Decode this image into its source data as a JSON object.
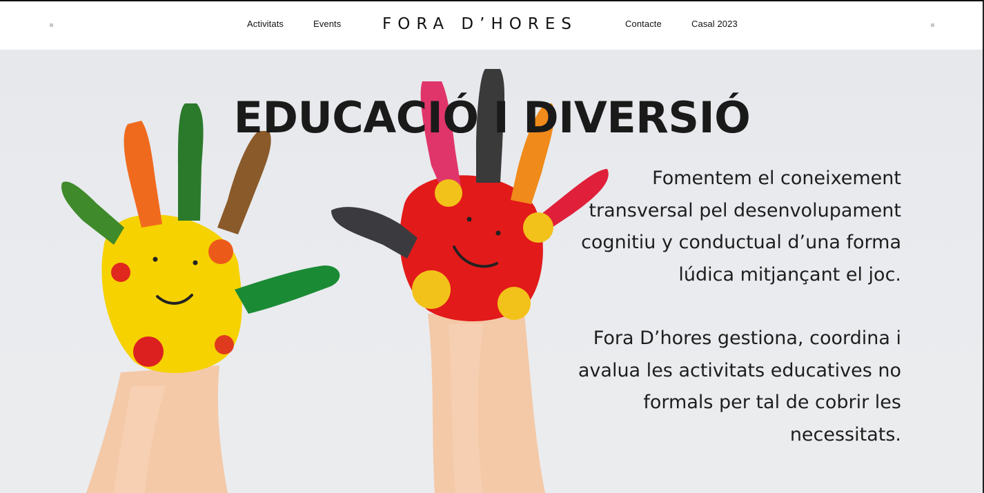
{
  "header": {
    "logo": "FORA D’HORES",
    "nav_left": [
      {
        "label": "Activitats"
      },
      {
        "label": "Events"
      }
    ],
    "nav_right": [
      {
        "label": "Contacte"
      },
      {
        "label": "Casal 2023"
      }
    ]
  },
  "hero": {
    "title": "EDUCACIÓ I DIVERSIÓ",
    "paragraph_1": "Fomentem el coneixement transversal pel desenvolupament cognitiu y conductual d’una forma lúdica mitjançant el joc.",
    "paragraph_2": "Fora D’hores gestiona, coordina i avalua les activitats educatives no formals per tal de cobrir les necessitats.",
    "image": "painted-hands-photo"
  },
  "colors": {
    "text": "#111111",
    "background": "#e8eaed",
    "paint_yellow": "#f5d400",
    "paint_red": "#e41e1e",
    "paint_green": "#1f8a3a",
    "paint_orange": "#f08a1a"
  }
}
